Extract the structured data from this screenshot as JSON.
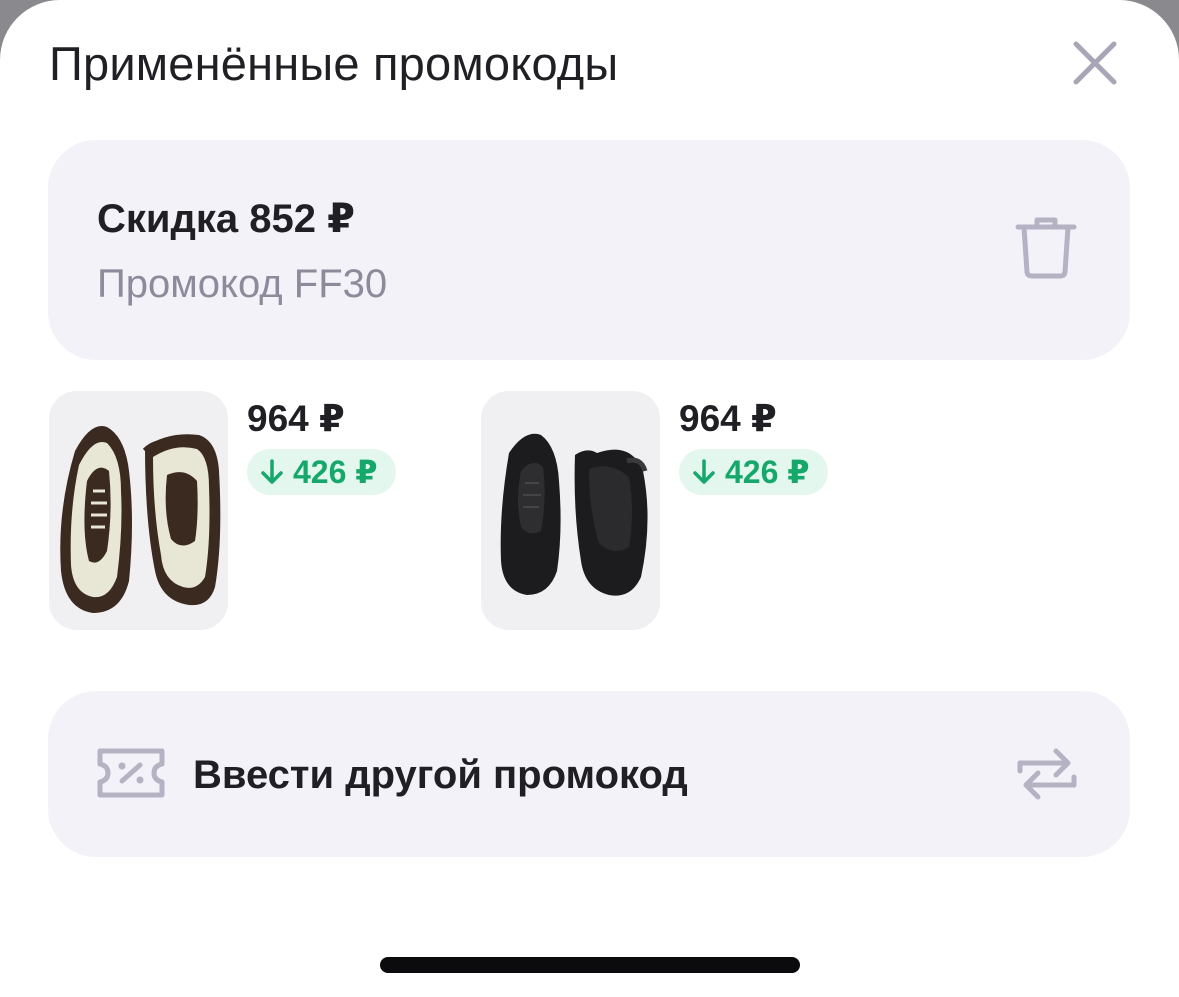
{
  "header": {
    "title": "Применённые промокоды",
    "close_icon": "close-icon"
  },
  "promo": {
    "discount": "Скидка 852 ₽",
    "code": "Промокод FF30",
    "delete_icon": "trash-icon"
  },
  "products": [
    {
      "price": "964 ₽",
      "discount": "426 ₽",
      "image": "sneaker-cream-brown",
      "arrow_icon": "arrow-down-icon"
    },
    {
      "price": "964 ₽",
      "discount": "426 ₽",
      "image": "sneaker-black",
      "arrow_icon": "arrow-down-icon"
    }
  ],
  "enter_other": {
    "label": "Ввести другой промокод",
    "leading_icon": "coupon-icon",
    "trailing_icon": "swap-icon"
  },
  "colors": {
    "accent_green": "#16a86a",
    "badge_bg": "#e3f7ef",
    "card_bg": "#f3f2f8",
    "muted": "#8d8b9b"
  }
}
